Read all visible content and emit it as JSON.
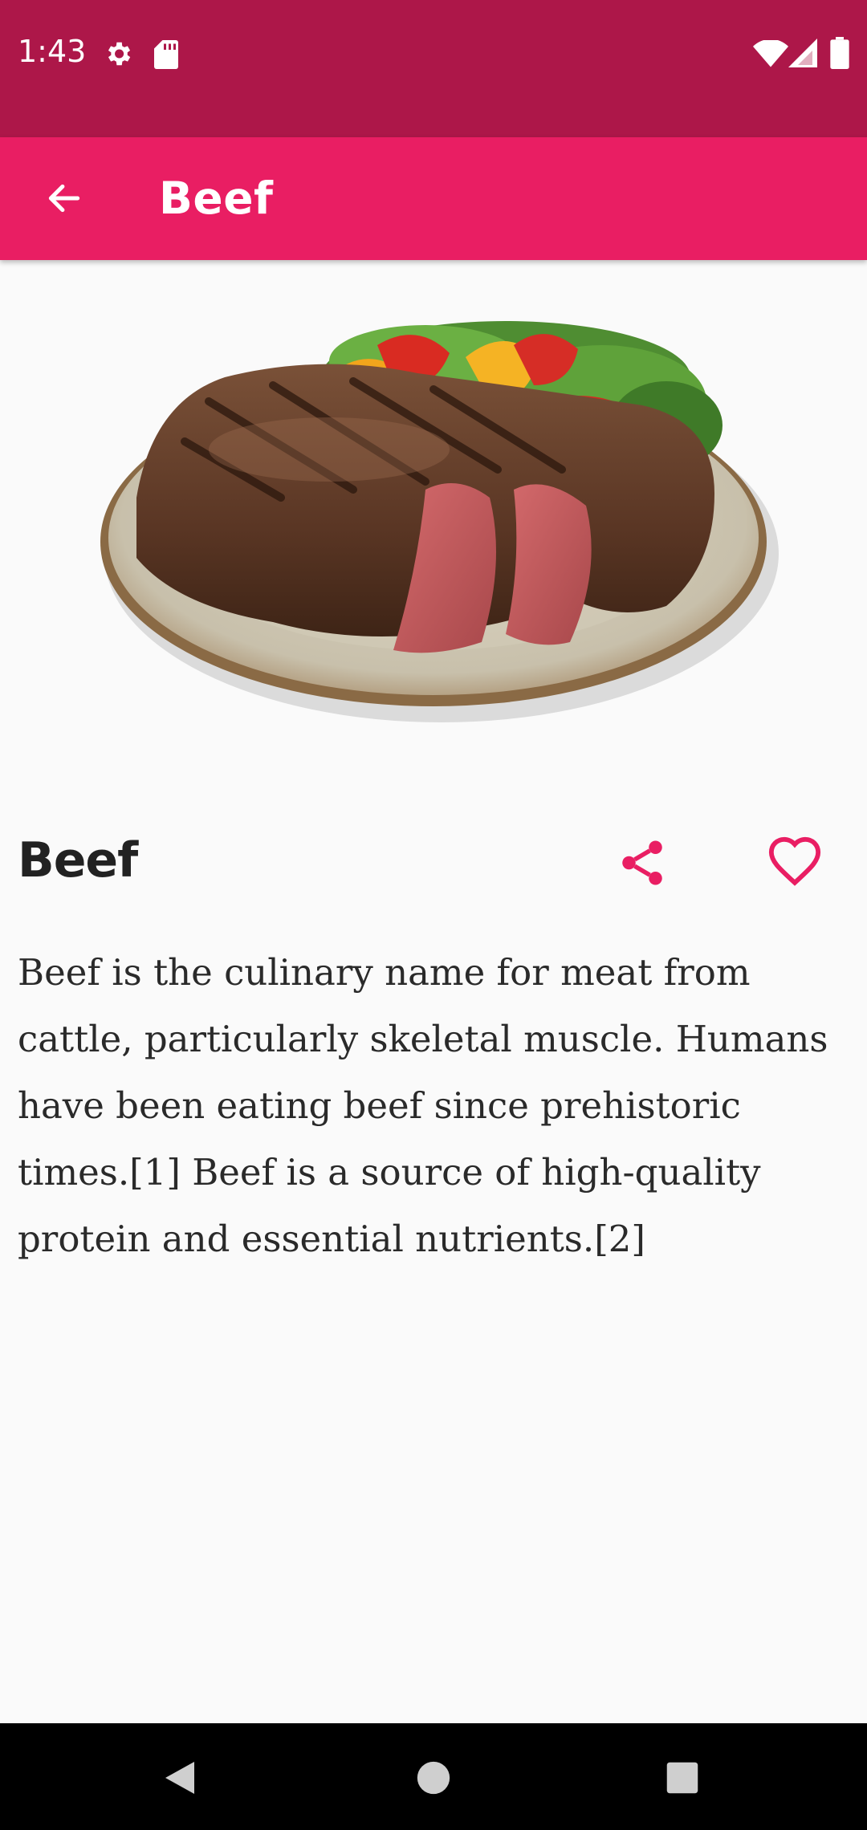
{
  "status_bar": {
    "time": "1:43",
    "icons": [
      "settings-icon",
      "sd-card-icon",
      "wifi-icon",
      "signal-icon",
      "battery-icon"
    ]
  },
  "app_bar": {
    "title": "Beef",
    "back_icon": "arrow-back-icon"
  },
  "hero": {
    "image": "grilled-steak-with-salad-on-plate"
  },
  "item": {
    "title": "Beef",
    "description": "Beef is the culinary name for meat from cattle, particularly skeletal muscle. Humans have been eating beef since prehistoric times.[1] Beef is a source of high-quality protein and essential nutrients.[2]",
    "share_icon": "share-icon",
    "favorite_icon": "heart-outline-icon"
  },
  "nav_bar": {
    "icons": [
      "nav-back-icon",
      "nav-home-icon",
      "nav-recents-icon"
    ]
  },
  "colors": {
    "status_bar": "#ad1749",
    "app_bar": "#e91e63",
    "accent": "#e91e63",
    "background": "#fafafa"
  }
}
